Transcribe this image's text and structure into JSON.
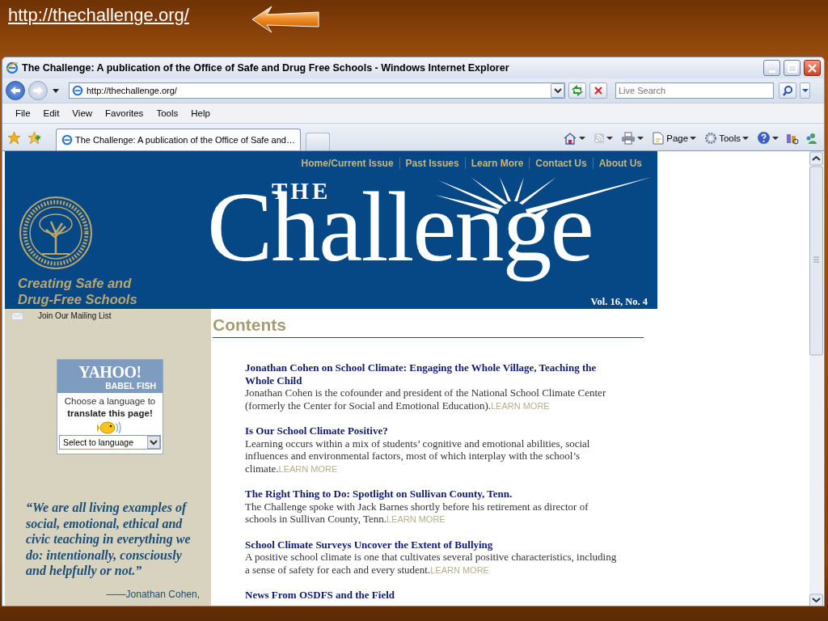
{
  "slide": {
    "link": "http://thechallenge.org/"
  },
  "window": {
    "title": "The Challenge: A publication of the Office of Safe and Drug Free Schools - Windows Internet Explorer"
  },
  "address_bar": {
    "url": "http://thechallenge.org/"
  },
  "search": {
    "placeholder": "Live Search"
  },
  "menu": [
    "File",
    "Edit",
    "View",
    "Favorites",
    "Tools",
    "Help"
  ],
  "tabs": [
    {
      "label": "The Challenge: A publication of the Office of Safe and…",
      "selected": true
    }
  ],
  "command_bar": [
    "Page",
    "Tools"
  ],
  "banner": {
    "nav": [
      "Home/Current Issue",
      "Past Issues",
      "Learn More",
      "Contact Us",
      "About Us"
    ],
    "logo_top": "THE",
    "logo": "Challenge",
    "tagline": "Creating Safe and Drug-Free Schools",
    "volume": "Vol. 16, No. 4"
  },
  "sidebar": {
    "mailing_list": "Join Our Mailing List",
    "translator": {
      "brand": "YAHOO!",
      "sub": "BABEL FISH",
      "prompt": "Choose a language to",
      "prompt_bold": "translate this page!",
      "select": "Select to language"
    },
    "quote": "“We are all living examples of social, emotional, ethical and civic teaching in everything we do: intentionally, consciously and helpfully or not.”",
    "attribution": "——Jonathan Cohen,"
  },
  "contents": {
    "heading": "Contents",
    "articles": [
      {
        "title": "Jonathan Cohen on School Climate: Engaging the Whole Village, Teaching the Whole Child",
        "summary": "Jonathan Cohen is the cofounder and president of the National School Climate Center (formerly the Center for Social and Emotional Education).",
        "link": "LEARN MORE"
      },
      {
        "title": "Is Our School Climate Positive?",
        "summary": "Learning occurs within a mix of students’ cognitive and emotional abilities, social influences and environmental factors, most of which interplay with the school’s climate.",
        "link": "LEARN MORE"
      },
      {
        "title": "The Right Thing to Do: Spotlight on Sullivan County, Tenn.",
        "summary": "The Challenge spoke with Jack Barnes shortly before his retirement as director of schools in Sullivan County, Tenn.",
        "link": "LEARN MORE"
      },
      {
        "title": "School Climate Surveys Uncover the Extent of Bullying",
        "summary": "A positive school climate is one that cultivates several positive characteristics, including a sense of safety for each and every student.",
        "link": "LEARN MORE"
      },
      {
        "title": "News From OSDFS and the Field"
      }
    ]
  }
}
